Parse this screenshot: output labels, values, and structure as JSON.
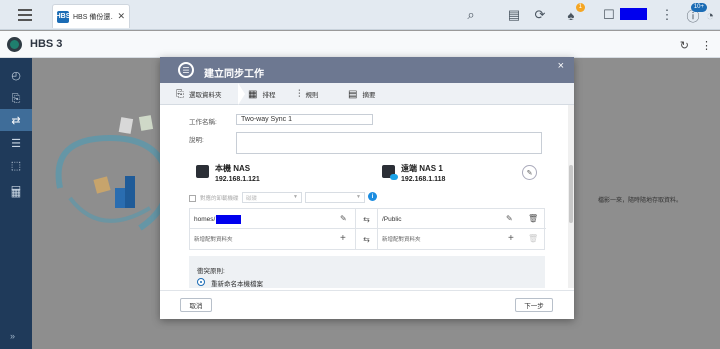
{
  "browser": {
    "tab_label": "HBS 備份還...",
    "tab_icon_text": "HBS",
    "notifications_badge": "1",
    "info_badge": "10+"
  },
  "app": {
    "title": "HBS 3"
  },
  "background": {
    "description_text": "檔影一來，隨時隨地存取資料。"
  },
  "dialog": {
    "title": "建立同步工作",
    "steps": [
      {
        "label": "選取資料夾"
      },
      {
        "label": "排程"
      },
      {
        "label": "規則"
      },
      {
        "label": "摘要"
      }
    ],
    "job_name_label": "工作名稱:",
    "job_name_value": "Two-way Sync 1",
    "description_label": "說明:",
    "description_value": "",
    "local_nas": {
      "name": "本機 NAS",
      "ip": "192.168.1.121"
    },
    "remote_nas": {
      "name": "遠端 NAS 1",
      "ip": "192.168.1.118"
    },
    "map_label": "對應的卸載機碟",
    "select_placeholder": "磁碟",
    "rows": [
      {
        "left": "homes/",
        "right": "/Public"
      },
      {
        "left": "新增配對資料夾",
        "right": "新增配對資料夾"
      }
    ],
    "conflict_title": "衝突原則:",
    "conflict_option": "重新命名本機檔案",
    "cancel_label": "取消",
    "next_label": "下一步"
  },
  "colors": {
    "sidebar": "#1f3a5a",
    "modal_header": "#6d7891",
    "accent": "#1b6cb5"
  }
}
